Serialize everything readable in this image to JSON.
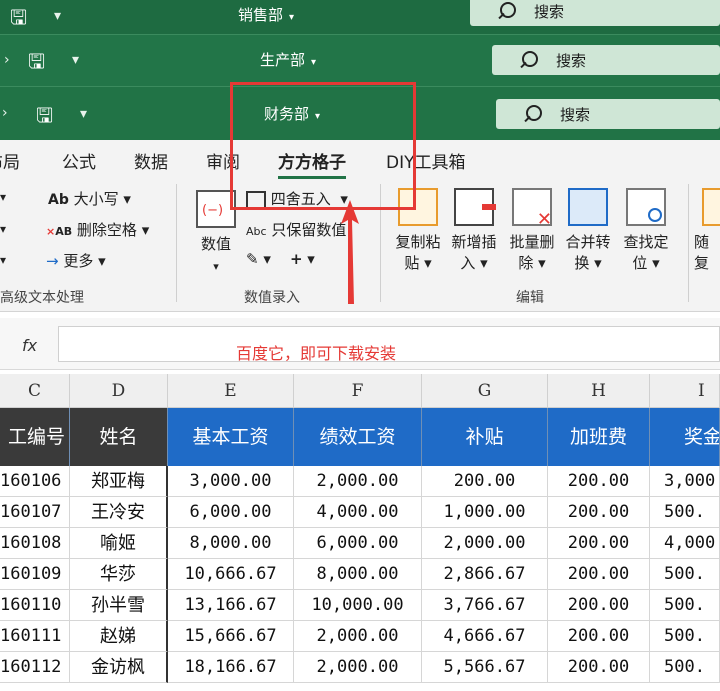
{
  "windows": [
    {
      "title": "销售部",
      "search": "搜索"
    },
    {
      "title": "生产部",
      "search": "搜索"
    },
    {
      "title": "财务部",
      "search": "搜索"
    }
  ],
  "tabs": [
    "布局",
    "公式",
    "数据",
    "审阅",
    "方方格子",
    "DIY工具箱"
  ],
  "ribbon": {
    "text_group": {
      "items": [
        "大小写",
        "删除空格",
        "更多"
      ],
      "label": "高级文本处理"
    },
    "number_group": {
      "numeric_btn": "数值",
      "round_btn": "四舍五入",
      "keep_numeric_btn": "只保留数值",
      "label": "数值录入"
    },
    "edit_group": {
      "buttons": [
        {
          "line1": "复制粘",
          "line2": "贴"
        },
        {
          "line1": "新增插",
          "line2": "入"
        },
        {
          "line1": "批量删",
          "line2": "除"
        },
        {
          "line1": "合并转",
          "line2": "换"
        },
        {
          "line1": "查找定",
          "line2": "位"
        },
        {
          "line1": "随",
          "line2": "复"
        }
      ],
      "label": "编辑"
    }
  },
  "formula_bar": {
    "fx": "fx",
    "annotation": "百度它，即可下载安装"
  },
  "columns": [
    "C",
    "D",
    "E",
    "F",
    "G",
    "H",
    "I"
  ],
  "table": {
    "headers": [
      "工编号",
      "姓名",
      "基本工资",
      "绩效工资",
      "补贴",
      "加班费",
      "奖金"
    ],
    "rows": [
      [
        "160106",
        "郑亚梅",
        "3,000.00",
        "2,000.00",
        "200.00",
        "200.00",
        "3,000"
      ],
      [
        "160107",
        "王冷安",
        "6,000.00",
        "4,000.00",
        "1,000.00",
        "200.00",
        "500."
      ],
      [
        "160108",
        "喻姬",
        "8,000.00",
        "6,000.00",
        "2,000.00",
        "200.00",
        "4,000"
      ],
      [
        "160109",
        "华莎",
        "10,666.67",
        "8,000.00",
        "2,866.67",
        "200.00",
        "500."
      ],
      [
        "160110",
        "孙半雪",
        "13,166.67",
        "10,000.00",
        "3,766.67",
        "200.00",
        "500."
      ],
      [
        "160111",
        "赵娣",
        "15,666.67",
        "2,000.00",
        "4,666.67",
        "200.00",
        "500."
      ],
      [
        "160112",
        "金访枫",
        "18,166.67",
        "2,000.00",
        "5,566.67",
        "200.00",
        "500."
      ]
    ]
  },
  "colors": {
    "excel_green": "#217346",
    "header_blue": "#1f6bc7",
    "annotation_red": "#e53935"
  }
}
